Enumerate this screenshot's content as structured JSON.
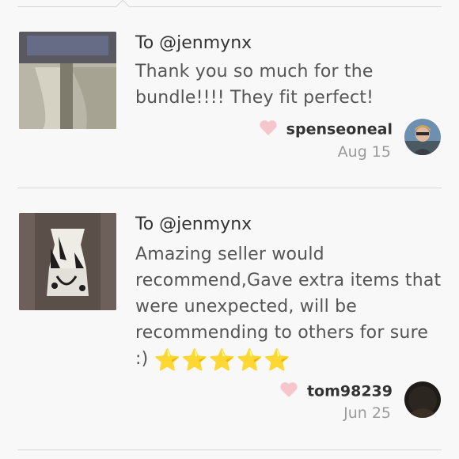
{
  "reviews": [
    {
      "to": "To @jenmynx",
      "text": "Thank you so much for the bundle!!!! They fit perfect!",
      "reviewer": "spenseoneal",
      "date": "Aug 15"
    },
    {
      "to": "To @jenmynx",
      "text": "Amazing seller would recommend,Gave extra items that were unexpected, will be recommending to others for sure :)",
      "stars": "⭐⭐⭐⭐⭐",
      "reviewer": "tom98239",
      "date": "Jun 25"
    }
  ],
  "icons": {
    "like": "heart-icon"
  },
  "colors": {
    "heart": "#f7c6cc",
    "background": "#f9f8f9",
    "divider": "#d8d6d8"
  }
}
